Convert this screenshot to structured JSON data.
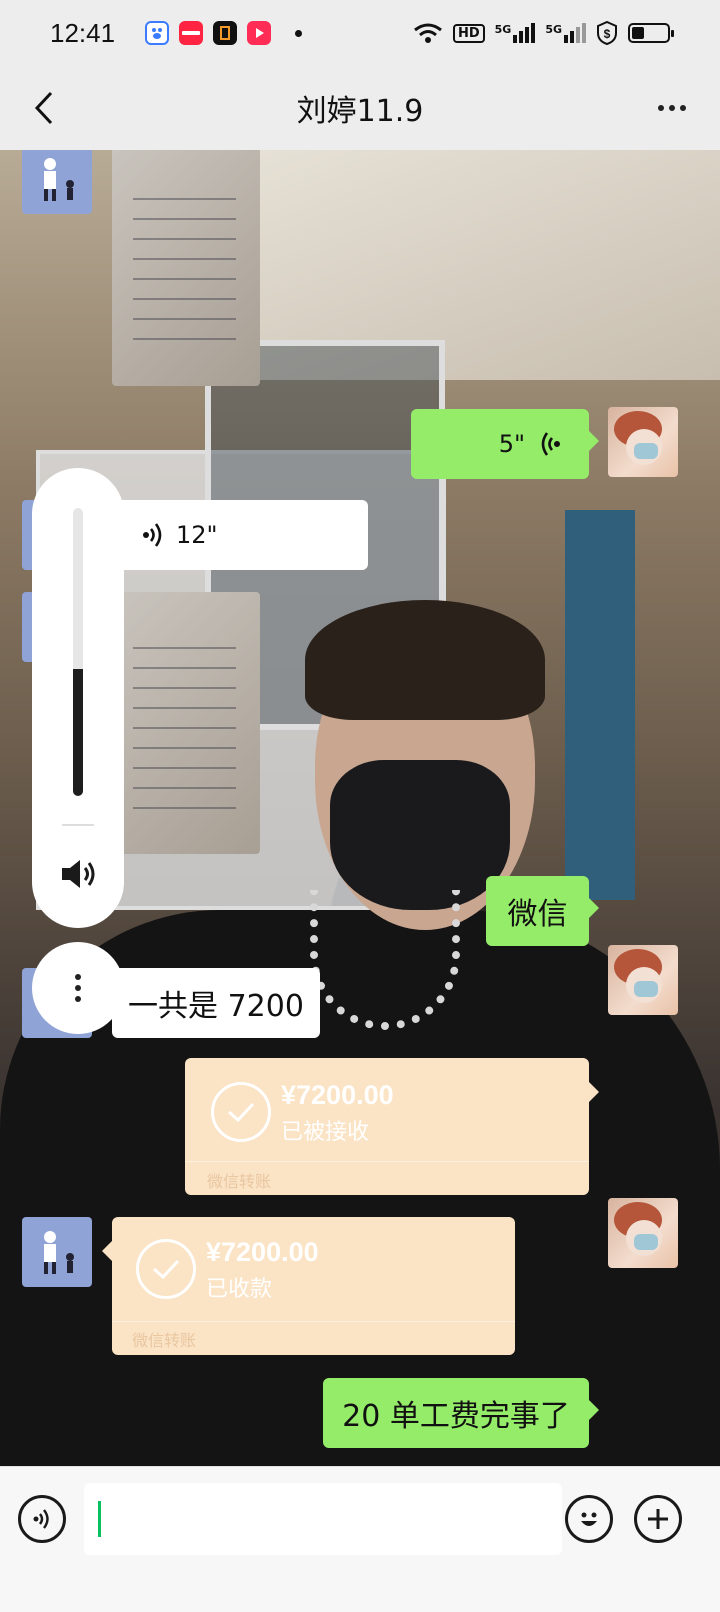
{
  "status_bar": {
    "time": "12:41",
    "apps": [
      "baidu-app-icon",
      "xiaohongshu-app-icon",
      "office-app-icon",
      "video-app-icon"
    ],
    "network": [
      "wifi-icon",
      "HD",
      "5G",
      "5G"
    ],
    "battery_level": 0.35
  },
  "header": {
    "title": "刘婷11.9",
    "back_icon": "chevron-left-icon",
    "more_icon": "more-dots-icon"
  },
  "messages": [
    {
      "side": "left",
      "type": "image",
      "content": "handwritten-list-photo"
    },
    {
      "side": "right",
      "type": "voice",
      "duration": "5\""
    },
    {
      "side": "left",
      "type": "voice",
      "duration": "12\""
    },
    {
      "side": "left",
      "type": "image",
      "content": "handwritten-list-photo"
    },
    {
      "side": "right",
      "type": "text",
      "text": "微信"
    },
    {
      "side": "left",
      "type": "text",
      "text": "一共是 7200"
    },
    {
      "side": "right",
      "type": "transfer",
      "amount": "¥7200.00",
      "status": "已被接收",
      "source": "微信转账"
    },
    {
      "side": "left",
      "type": "transfer",
      "amount": "¥7200.00",
      "status": "已收款",
      "source": "微信转账"
    },
    {
      "side": "right",
      "type": "text",
      "text": "20 单工费完事了"
    }
  ],
  "volume_panel": {
    "level": 0.44,
    "speaker_icon": "speaker-icon",
    "more_icon": "more-vertical-icon"
  },
  "input_bar": {
    "voice_icon": "voice-input-icon",
    "emoji_icon": "emoji-icon",
    "plus_icon": "plus-icon",
    "value": ""
  },
  "colors": {
    "my_bubble": "#95ec69",
    "their_bubble": "#ffffff",
    "transfer_bubble": "#fbe3c5",
    "caret": "#07c160"
  }
}
